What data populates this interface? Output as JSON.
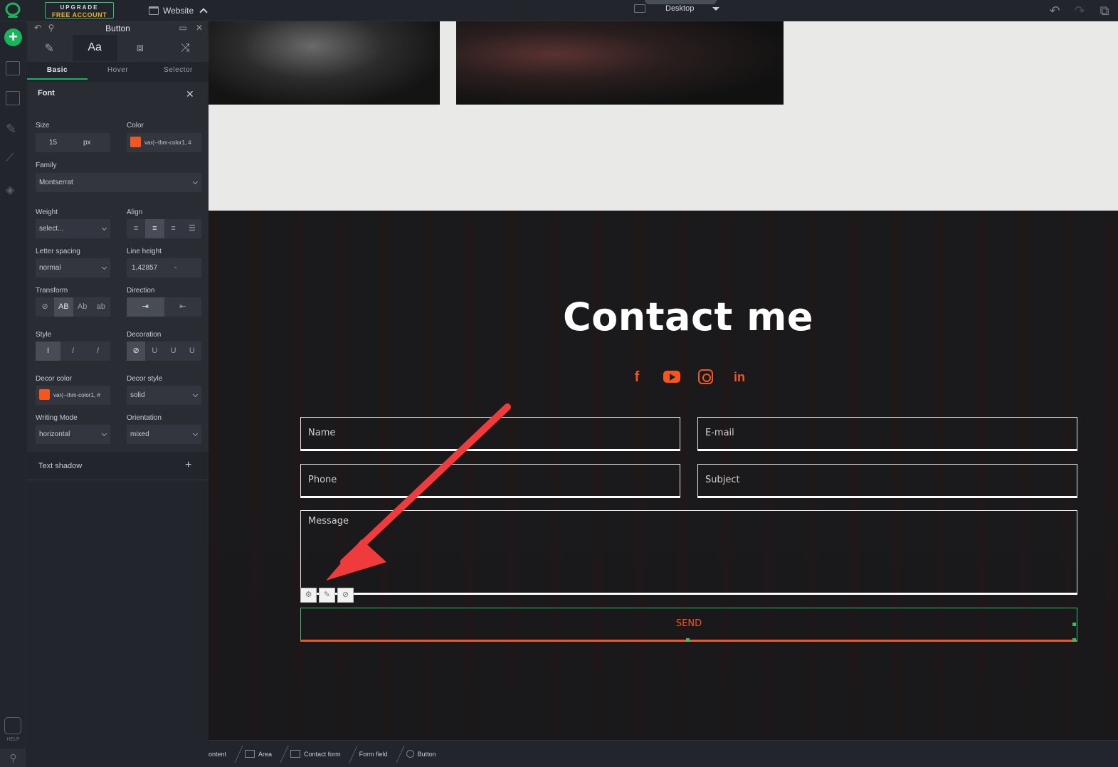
{
  "topbar": {
    "upgrade_line1": "UPGRADE",
    "upgrade_line2": "FREE ACCOUNT",
    "website_label": "Website",
    "device_label": "Desktop"
  },
  "panel": {
    "title": "Button",
    "subtabs": [
      "Basic",
      "Hover",
      "Selector"
    ],
    "section_title": "Font",
    "size_label": "Size",
    "size_value": "15",
    "size_unit": "px",
    "color_label": "Color",
    "color_value": "var(--thm-color1, #",
    "family_label": "Family",
    "family_value": "Montserrat",
    "weight_label": "Weight",
    "weight_value": "select...",
    "align_label": "Align",
    "letter_spacing_label": "Letter spacing",
    "letter_spacing_value": "normal",
    "line_height_label": "Line height",
    "line_height_value": "1,42857",
    "line_height_unit": "-",
    "transform_label": "Transform",
    "transform_options": [
      "AB",
      "Ab",
      "ab"
    ],
    "direction_label": "Direction",
    "style_label": "Style",
    "decoration_label": "Decoration",
    "decor_color_label": "Decor color",
    "decor_color_value": "var(--thm-color1, #",
    "decor_style_label": "Decor style",
    "decor_style_value": "solid",
    "writing_mode_label": "Writing Mode",
    "writing_mode_value": "horizontal",
    "orientation_label": "Orientation",
    "orientation_value": "mixed",
    "text_shadow_label": "Text shadow",
    "accent_color": "#f4561e"
  },
  "canvas": {
    "contact_title": "Contact me",
    "fields": {
      "name": "Name",
      "email": "E-mail",
      "phone": "Phone",
      "subject": "Subject",
      "message": "Message"
    },
    "send_label": "SEND"
  },
  "rail": {
    "help_label": "HELP"
  },
  "breadcrumbs": [
    "ontent",
    "Area",
    "Contact form",
    "Form field",
    "Button"
  ],
  "colors": {
    "brand_green": "#19b55c",
    "accent_orange": "#f4561e",
    "upgrade_yellow": "#f2b01e"
  }
}
